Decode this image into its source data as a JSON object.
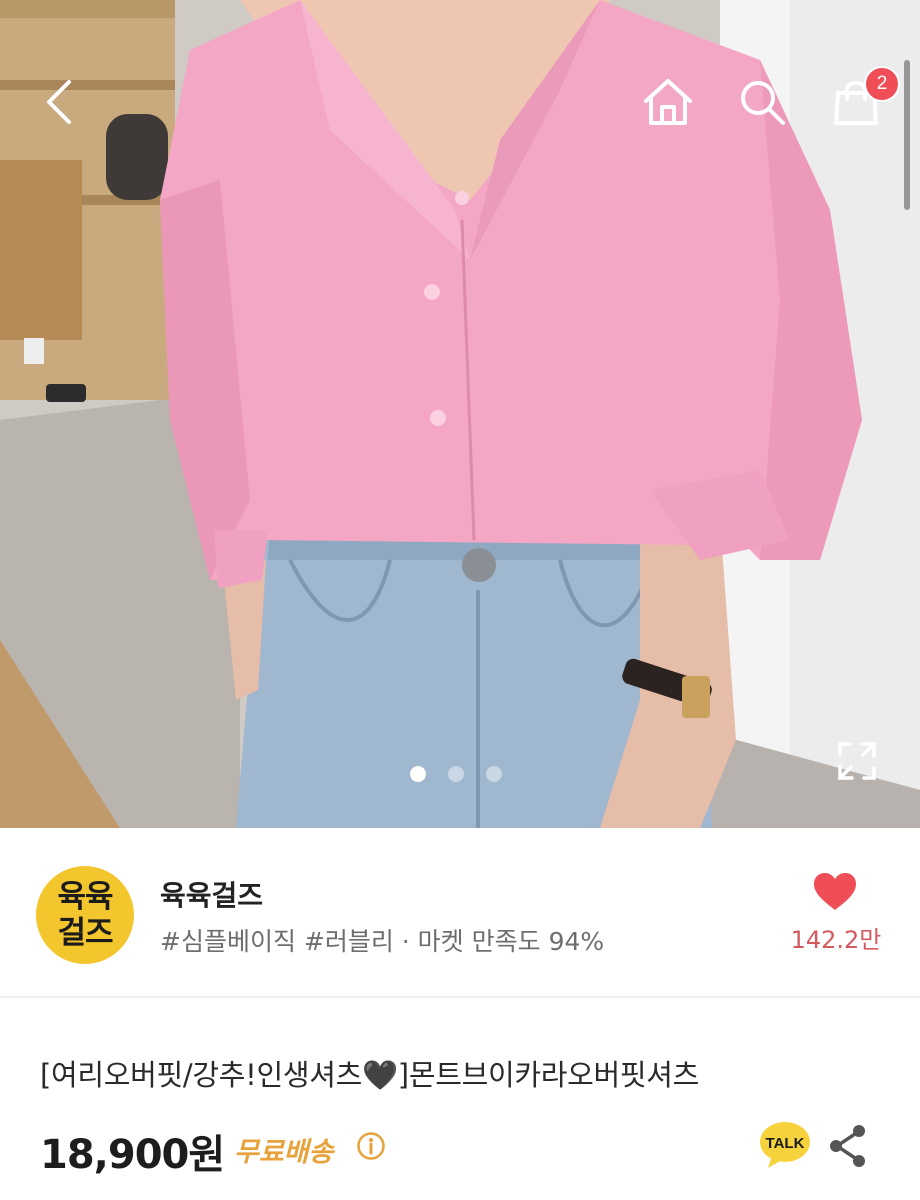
{
  "header": {
    "back_icon": "chevron-left-icon",
    "home_icon": "home-icon",
    "search_icon": "search-icon",
    "cart_icon": "shopping-bag-icon",
    "cart_count": "2"
  },
  "gallery": {
    "image_description_icon": "product-photo",
    "total_slides": 3,
    "active_slide": 1,
    "expand_icon": "expand-icon"
  },
  "seller": {
    "logo_line1": "육육",
    "logo_line2": "걸즈",
    "name": "육육걸즈",
    "tags": "#심플베이직 #러블리 · 마켓 만족도 94%",
    "like_count": "142.2만"
  },
  "product": {
    "title": "[여리오버핏/강추!인생셔츠🖤]몬트브이카라오버핏셔츠",
    "price": "18,900원",
    "shipping": "무료배송",
    "talk_label": "TALK"
  },
  "colors": {
    "accent_like": "#ef4e57",
    "shipping": "#e7a23b",
    "logo_bg": "#f4c62d"
  }
}
